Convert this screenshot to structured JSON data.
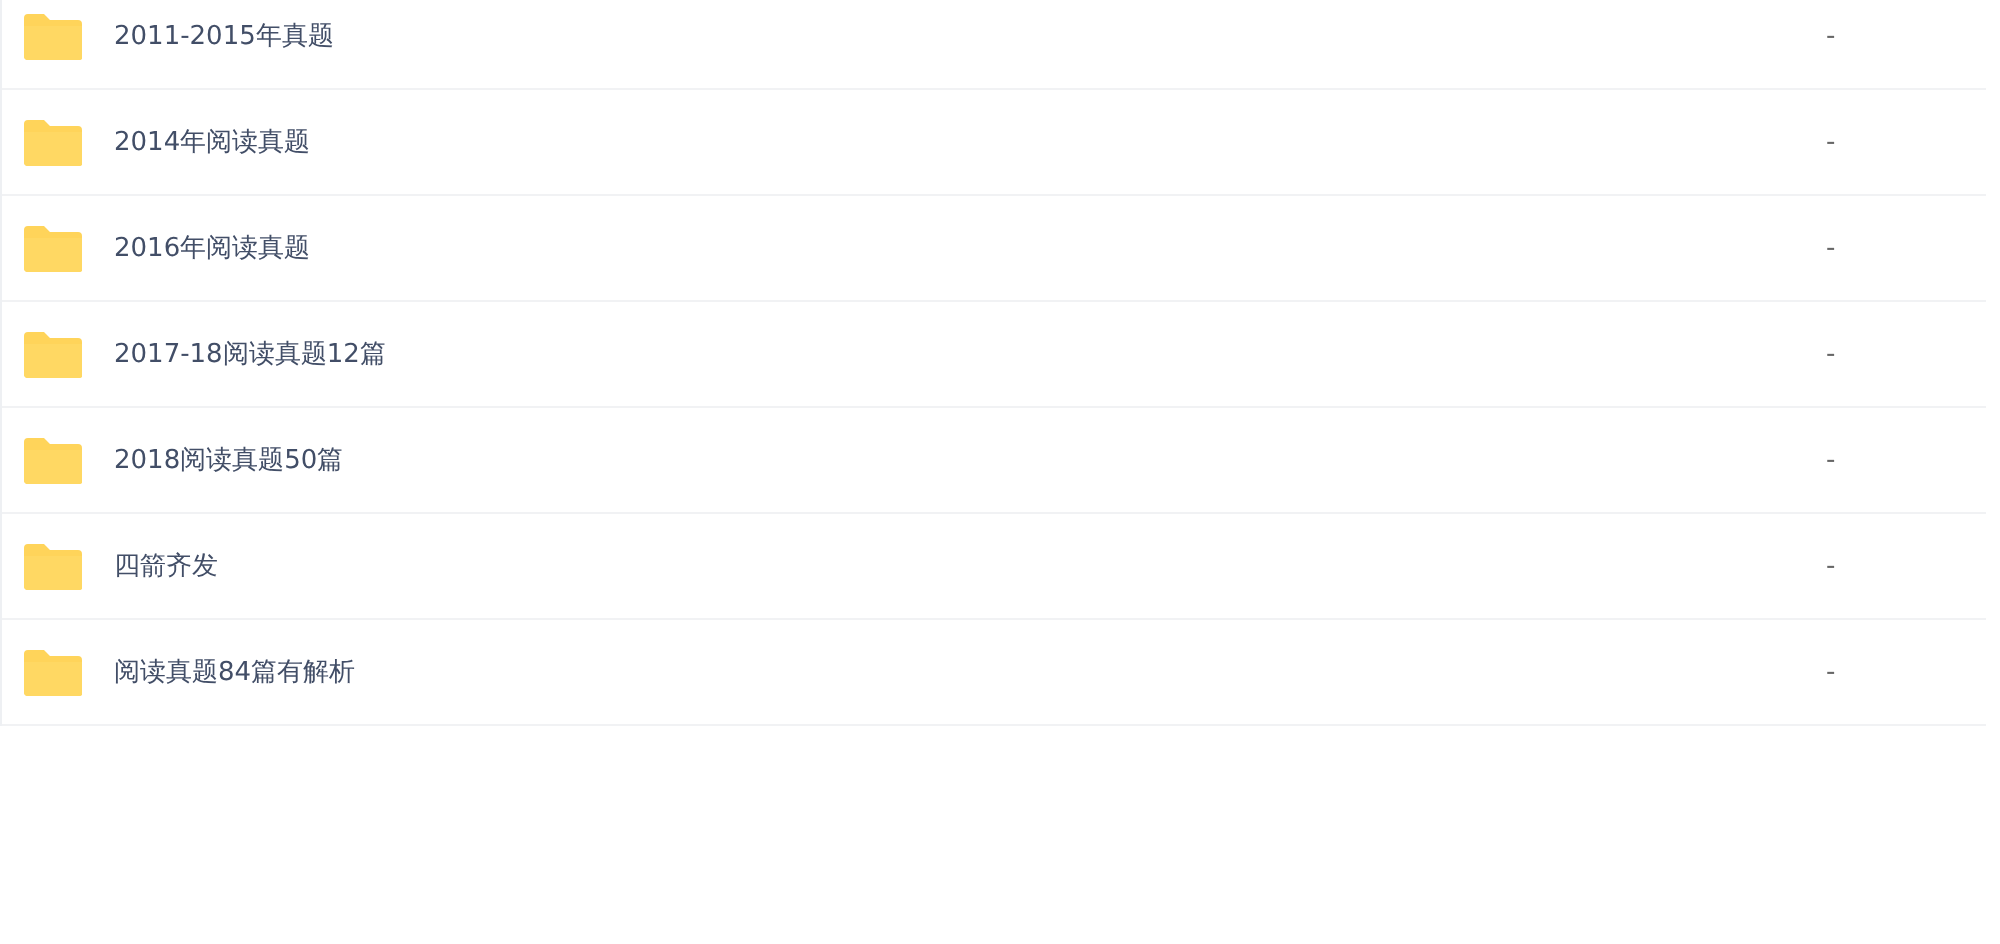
{
  "files": [
    {
      "name": "2011-2015年真题",
      "size": "-"
    },
    {
      "name": "2014年阅读真题",
      "size": "-"
    },
    {
      "name": "2016年阅读真题",
      "size": "-"
    },
    {
      "name": "2017-18阅读真题12篇",
      "size": "-"
    },
    {
      "name": "2018阅读真题50篇",
      "size": "-"
    },
    {
      "name": "四箭齐发",
      "size": "-"
    },
    {
      "name": "阅读真题84篇有解析",
      "size": "-"
    }
  ]
}
